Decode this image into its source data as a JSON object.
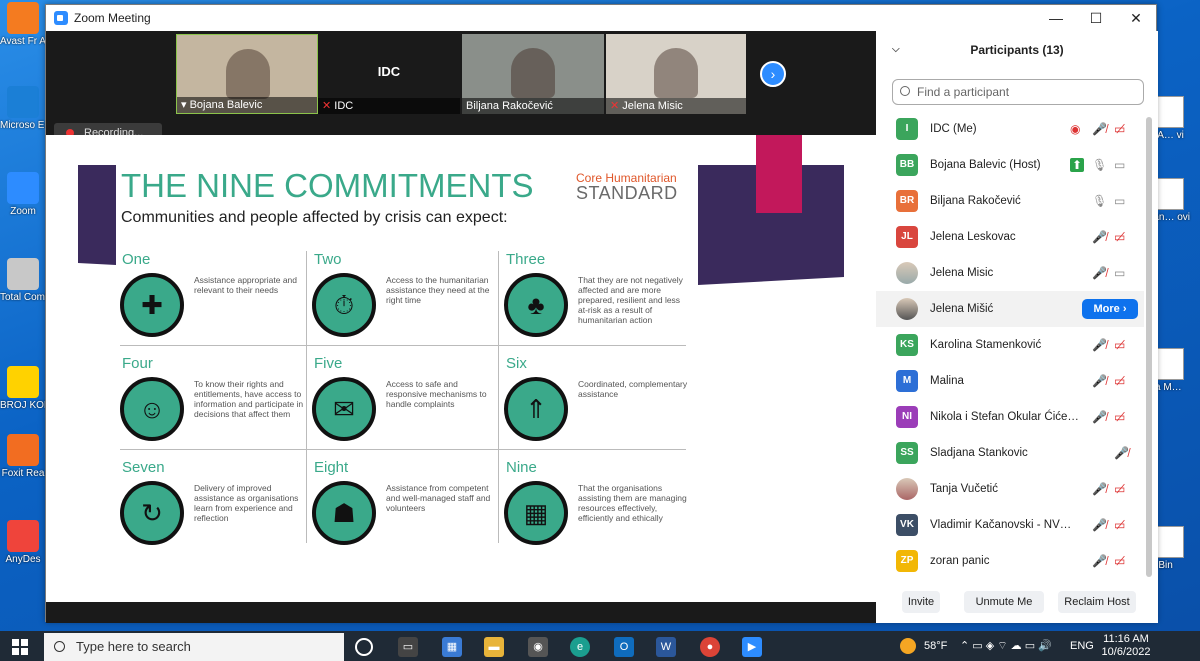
{
  "desktop": {
    "left_icons": [
      {
        "label": "Avast Fr Antiviru",
        "color": "#f47b20"
      },
      {
        "label": "Microso Edge",
        "color": "#1b7fd6"
      },
      {
        "label": "Zoom",
        "color": "#2d8cff"
      },
      {
        "label": "Total Comman",
        "color": "#c8c8c8"
      },
      {
        "label": "BROJ KORISNI",
        "color": "#ffd200"
      },
      {
        "label": "Foxit Rea",
        "color": "#f26d21"
      },
      {
        "label": "AnyDes",
        "color": "#ef443b"
      }
    ],
    "right_icons": [
      {
        "label": "RA… vi"
      },
      {
        "label": "ran… ovi"
      },
      {
        "label": "ka M…"
      },
      {
        "label": "e Bin"
      }
    ]
  },
  "window": {
    "title": "Zoom Meeting",
    "min": "—",
    "max": "☐",
    "close": "✕"
  },
  "video": {
    "thumbnails": [
      {
        "name": "Bojana Balevic",
        "pin": "📌",
        "bg": "#c4b6a0"
      },
      {
        "name": "IDC",
        "label": "IDC",
        "muted": true,
        "bg": "#1a1a1a"
      },
      {
        "name": "Biljana Rakočević",
        "bg": "#8a8f8a"
      },
      {
        "name": "Jelena Misic",
        "muted": true,
        "bg": "#d8d2c8"
      }
    ],
    "recording": "Recording...",
    "next": "›"
  },
  "slide": {
    "title": "THE NINE COMMITMENTS",
    "subtitle": "Communities and people affected by crisis can expect:",
    "brand_top": "Core Humanitarian",
    "brand_bottom": "STANDARD",
    "commitments": [
      {
        "num": "One",
        "icon": "puzzle-icon",
        "glyph": "✚",
        "text": "Assistance appropriate and relevant to their needs"
      },
      {
        "num": "Two",
        "icon": "stopwatch-icon",
        "glyph": "⏱",
        "text": "Access to the humanitarian assistance they need at the right time"
      },
      {
        "num": "Three",
        "icon": "tree-icon",
        "glyph": "♣",
        "text": "That they are not negatively affected and are more prepared, resilient and less at-risk as a result of humanitarian action"
      },
      {
        "num": "Four",
        "icon": "speech-people-icon",
        "glyph": "☺",
        "text": "To know their rights and entitlements, have access to information and participate in decisions that affect them"
      },
      {
        "num": "Five",
        "icon": "envelope-hand-icon",
        "glyph": "✉",
        "text": "Access to safe and responsive mechanisms to handle complaints"
      },
      {
        "num": "Six",
        "icon": "arrows-up-icon",
        "glyph": "⇑",
        "text": "Coordinated, complementary assistance"
      },
      {
        "num": "Seven",
        "icon": "cycle-arrow-icon",
        "glyph": "↻",
        "text": "Delivery of improved assistance as organisations learn from experience and reflection"
      },
      {
        "num": "Eight",
        "icon": "staff-icon",
        "glyph": "☗",
        "text": "Assistance from competent and well-managed staff and volunteers"
      },
      {
        "num": "Nine",
        "icon": "boxes-person-icon",
        "glyph": "▦",
        "text": "That the organisations assisting them are managing resources effectively, efficiently and ethically"
      }
    ]
  },
  "participants": {
    "title": "Participants (13)",
    "search_placeholder": "Find a participant",
    "more_label": "More ›",
    "list": [
      {
        "initials": "I",
        "name": "IDC (Me)",
        "color": "#3ba55c",
        "icons": [
          "◉",
          "🎤̸",
          "▭̸"
        ]
      },
      {
        "initials": "BB",
        "name": "Bojana Balevic (Host)",
        "color": "#3ba55c",
        "icons": [
          "⬆",
          "🎙",
          "▭"
        ]
      },
      {
        "initials": "BR",
        "name": "Biljana Rakočević",
        "color": "#e8703a",
        "icons": [
          "🎙",
          "▭"
        ]
      },
      {
        "initials": "JL",
        "name": "Jelena Leskovac",
        "color": "#d9463e",
        "icons": [
          "🎤̸",
          "▭̸"
        ]
      },
      {
        "initials": "",
        "name": "Jelena Misic",
        "color": "#9aa",
        "photo": true,
        "icons": [
          "🎤̸",
          "▭"
        ]
      },
      {
        "initials": "",
        "name": "Jelena Mišić",
        "color": "#555",
        "photo": true,
        "highlight": true,
        "icons": []
      },
      {
        "initials": "KS",
        "name": "Karolina Stamenković",
        "color": "#3ba55c",
        "icons": [
          "🎤̸",
          "▭̸"
        ]
      },
      {
        "initials": "M",
        "name": "Malina",
        "color": "#2d6fd6",
        "icons": [
          "🎤̸",
          "▭̸"
        ]
      },
      {
        "initials": "NI",
        "name": "Nikola i Stefan Okular Ćićevac",
        "color": "#9b3db8",
        "icons": [
          "🎤̸",
          "▭̸"
        ]
      },
      {
        "initials": "SS",
        "name": "Sladjana Stankovic",
        "color": "#3ba55c",
        "icons": [
          "🎤̸"
        ]
      },
      {
        "initials": "",
        "name": "Tanja Vučetić",
        "color": "#a66",
        "photo": true,
        "icons": [
          "🎤̸",
          "▭̸"
        ]
      },
      {
        "initials": "VK",
        "name": "Vladimir Kačanovski - NVO Sal...",
        "color": "#3c4e66",
        "icons": [
          "🎤̸",
          "▭̸"
        ]
      },
      {
        "initials": "ZP",
        "name": "zoran panic",
        "color": "#f2b705",
        "icons": [
          "🎤̸",
          "▭̸"
        ]
      }
    ],
    "buttons": {
      "invite": "Invite",
      "unmute": "Unmute Me",
      "reclaim": "Reclaim Host"
    }
  },
  "taskbar": {
    "search_placeholder": "Type here to search",
    "temp": "58°F",
    "lang": "ENG",
    "time": "11:16 AM",
    "date": "10/6/2022"
  }
}
